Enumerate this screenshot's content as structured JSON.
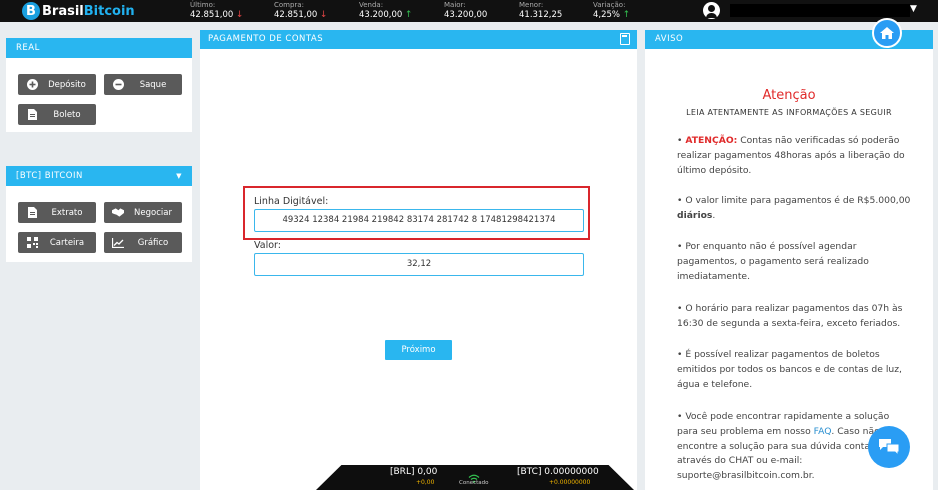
{
  "brand": {
    "part1": "Brasil",
    "part2": "Bitcoin"
  },
  "ticker": [
    {
      "label": "Último:",
      "value": "42.851,00",
      "dir": "down"
    },
    {
      "label": "Compra:",
      "value": "42.851,00",
      "dir": "down"
    },
    {
      "label": "Venda:",
      "value": "43.200,00",
      "dir": "up"
    },
    {
      "label": "Maior:",
      "value": "43.200,00",
      "dir": ""
    },
    {
      "label": "Menor:",
      "value": "41.312,25",
      "dir": ""
    },
    {
      "label": "Variação:",
      "value": "4,25%",
      "dir": "up"
    }
  ],
  "left": {
    "real_header": "REAL",
    "real_buttons": {
      "deposito": "Depósito",
      "saque": "Saque",
      "boleto": "Boleto"
    },
    "btc_header": "[BTC] BITCOIN",
    "btc_buttons": {
      "extrato": "Extrato",
      "negociar": "Negociar",
      "carteira": "Carteira",
      "grafico": "Gráfico"
    }
  },
  "center": {
    "header": "PAGAMENTO DE CONTAS",
    "linha_label": "Linha Digitável:",
    "linha_value": "49324 12384 21984 219842 83174 281742 8 17481298421374",
    "valor_label": "Valor:",
    "valor_value": "32,12",
    "next_button": "Próximo"
  },
  "status": {
    "brl": "[BRL] 0,00",
    "brl_sub": "+0,00",
    "connection": "Conectado",
    "btc": "[BTC] 0.00000000",
    "btc_sub": "+0.00000000"
  },
  "right": {
    "header": "AVISO",
    "title": "Atenção",
    "subtitle": "LEIA ATENTAMENTE AS INFORMAÇÕES A SEGUIR",
    "n1_red": "ATENÇÃO:",
    "n1_text": " Contas não verificadas só poderão realizar pagamentos 48horas após a liberação do último depósito.",
    "n2_text": "O valor limite para pagamentos é de R$5.000,00 ",
    "n2_tail": "diários",
    "n2_end": ".",
    "n3": "Por enquanto não é possível agendar pagamentos, o pagamento será realizado imediatamente.",
    "n4": "O horário para realizar pagamentos das 07h às 16:30 de segunda a sexta-feira, exceto feriados.",
    "n5": "É possível realizar pagamentos de boletos emitidos por todos os bancos e de contas de luz, água e telefone.",
    "n6_a": "Você pode encontrar rapidamente a solução para seu problema em nosso ",
    "n6_link": "FAQ",
    "n6_b": ". Caso não encontre a solução para sua dúvida contate através do CHAT ou e-mail: suporte@brasilbitcoin.com.br."
  },
  "colors": {
    "accent": "#29b6f0",
    "alert": "#e02a2a",
    "button": "#5a5a5a",
    "up": "#33c050",
    "down": "#e14545"
  }
}
